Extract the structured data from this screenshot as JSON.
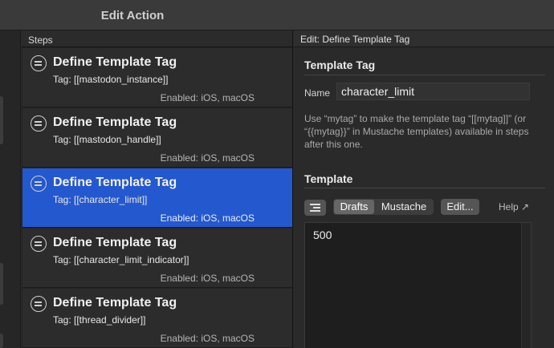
{
  "window": {
    "title": "Edit Action"
  },
  "steps": {
    "header": "Steps",
    "items": [
      {
        "name": "Define Template Tag",
        "tag": "Tag: [[mastodon_instance]]",
        "enabled": "Enabled: iOS, macOS",
        "selected": false
      },
      {
        "name": "Define Template Tag",
        "tag": "Tag: [[mastodon_handle]]",
        "enabled": "Enabled: iOS, macOS",
        "selected": false
      },
      {
        "name": "Define Template Tag",
        "tag": "Tag: [[character_limit]]",
        "enabled": "Enabled: iOS, macOS",
        "selected": true
      },
      {
        "name": "Define Template Tag",
        "tag": "Tag: [[character_limit_indicator]]",
        "enabled": "Enabled: iOS, macOS",
        "selected": false
      },
      {
        "name": "Define Template Tag",
        "tag": "Tag: [[thread_divider]]",
        "enabled": "Enabled: iOS, macOS",
        "selected": false
      }
    ]
  },
  "detail": {
    "header": "Edit: Define Template Tag",
    "template_tag_section": "Template Tag",
    "name_label": "Name",
    "name_value": "character_limit",
    "help_text": "Use “mytag” to make the template tag “[[mytag]]” (or “{{mytag}}” in Mustache templates) available in steps after this one.",
    "template_section": "Template",
    "toolbar": {
      "format_icon": "text-format-icon",
      "mode_options": [
        "Drafts",
        "Mustache"
      ],
      "mode_selected": "Drafts",
      "edit_label": "Edit...",
      "help_label": "Help ↗"
    },
    "template_value": "500"
  },
  "colors": {
    "selection": "#2458cf",
    "background": "#2a2a2a"
  }
}
